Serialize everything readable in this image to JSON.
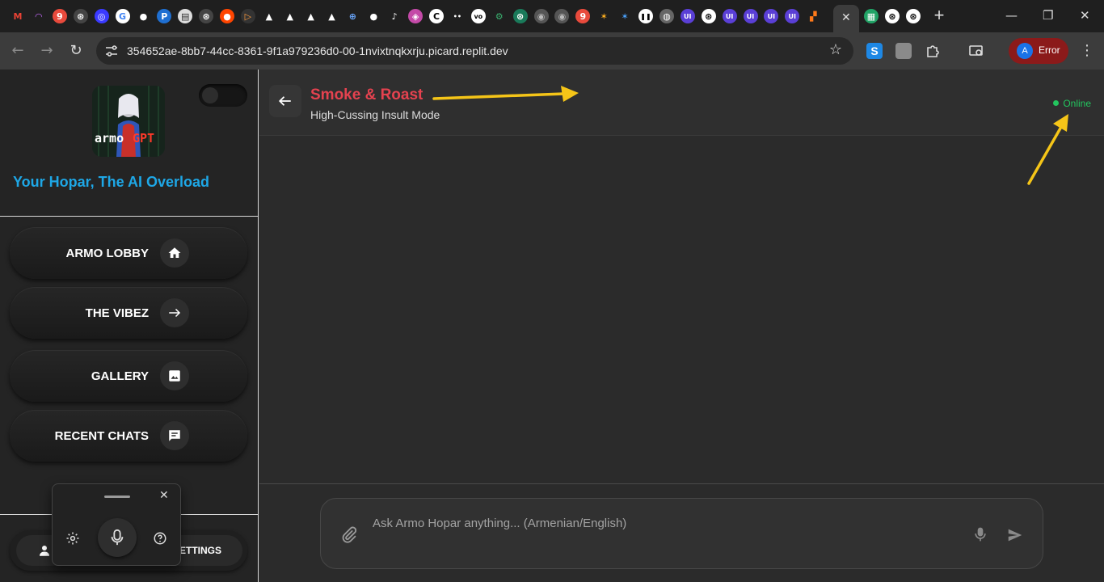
{
  "browser": {
    "url": "354652ae-8bb7-44cc-8361-9f1a979236d0-00-1nvixtnqkxrju.picard.replit.dev",
    "profile_label": "Error",
    "profile_initial": "A",
    "new_tab_glyph": "+",
    "tab_close_glyph": "✕",
    "favicons": [
      {
        "icon": "gmail-icon",
        "glyph": "M",
        "color": "#ea4335",
        "bg": "transparent"
      },
      {
        "icon": "rainbow-icon",
        "glyph": "◠",
        "color": "#c86cff",
        "bg": "transparent"
      },
      {
        "icon": "nine-icon",
        "glyph": "9",
        "color": "#fff",
        "bg": "#e84a3c"
      },
      {
        "icon": "openai-icon",
        "glyph": "⊛",
        "color": "#fff",
        "bg": "#444"
      },
      {
        "icon": "circle-blue-icon",
        "glyph": "◎",
        "color": "#fff",
        "bg": "#3a3aff"
      },
      {
        "icon": "google-icon",
        "glyph": "G",
        "color": "#4285f4",
        "bg": "#fff"
      },
      {
        "icon": "github-icon",
        "glyph": "●",
        "color": "#fff",
        "bg": "transparent"
      },
      {
        "icon": "paypal-icon",
        "glyph": "P",
        "color": "#fff",
        "bg": "#1f6fd1"
      },
      {
        "icon": "doc-icon",
        "glyph": "▤",
        "color": "#333",
        "bg": "#ddd"
      },
      {
        "icon": "openai-icon",
        "glyph": "⊛",
        "color": "#fff",
        "bg": "#444"
      },
      {
        "icon": "reddit-icon",
        "glyph": "●",
        "color": "#fff",
        "bg": "#ff4500"
      },
      {
        "icon": "play-icon",
        "glyph": "▷",
        "color": "#ff9b3d",
        "bg": "#333"
      },
      {
        "icon": "triangle-icon",
        "glyph": "▲",
        "color": "#fff",
        "bg": "transparent"
      },
      {
        "icon": "triangle-icon",
        "glyph": "▲",
        "color": "#fff",
        "bg": "transparent"
      },
      {
        "icon": "triangle-icon",
        "glyph": "▲",
        "color": "#fff",
        "bg": "transparent"
      },
      {
        "icon": "triangle-icon",
        "glyph": "▲",
        "color": "#fff",
        "bg": "transparent"
      },
      {
        "icon": "plus-circle-icon",
        "glyph": "⊕",
        "color": "#6aa8ff",
        "bg": "transparent"
      },
      {
        "icon": "github-icon",
        "glyph": "●",
        "color": "#fff",
        "bg": "transparent"
      },
      {
        "icon": "tiktok-icon",
        "glyph": "♪",
        "color": "#fff",
        "bg": "transparent"
      },
      {
        "icon": "gradient-icon",
        "glyph": "◈",
        "color": "#fff",
        "bg": "#c44aa8"
      },
      {
        "icon": "c-icon",
        "glyph": "C",
        "color": "#000",
        "bg": "#fff"
      },
      {
        "icon": "dots-icon",
        "glyph": "••",
        "color": "#fff",
        "bg": "transparent"
      },
      {
        "icon": "vo-icon",
        "glyph": "vo",
        "color": "#000",
        "bg": "#fff"
      },
      {
        "icon": "grid-icon",
        "glyph": "⚙",
        "color": "#3ab06f",
        "bg": "transparent"
      },
      {
        "icon": "openai-icon",
        "glyph": "⊛",
        "color": "#fff",
        "bg": "#1a7a5a"
      },
      {
        "icon": "avatar-icon",
        "glyph": "◉",
        "color": "#bbb",
        "bg": "#555"
      },
      {
        "icon": "avatar-icon",
        "glyph": "◉",
        "color": "#bbb",
        "bg": "#555"
      },
      {
        "icon": "nine-icon",
        "glyph": "9",
        "color": "#fff",
        "bg": "#e84a3c"
      },
      {
        "icon": "figure-icon",
        "glyph": "✶",
        "color": "#ffb020",
        "bg": "transparent"
      },
      {
        "icon": "figure-icon",
        "glyph": "✶",
        "color": "#4aa3ff",
        "bg": "transparent"
      },
      {
        "icon": "pause-icon",
        "glyph": "❚❚",
        "color": "#000",
        "bg": "#fff"
      },
      {
        "icon": "chrome-icon",
        "glyph": "◍",
        "color": "#fff",
        "bg": "#666"
      },
      {
        "icon": "ui-icon",
        "glyph": "UI",
        "color": "#fff",
        "bg": "#5a3fd6"
      },
      {
        "icon": "openai-icon",
        "glyph": "⊛",
        "color": "#000",
        "bg": "#fff"
      },
      {
        "icon": "ui-icon",
        "glyph": "UI",
        "color": "#fff",
        "bg": "#5a3fd6"
      },
      {
        "icon": "ui-icon",
        "glyph": "UI",
        "color": "#fff",
        "bg": "#5a3fd6"
      },
      {
        "icon": "ui-icon",
        "glyph": "UI",
        "color": "#fff",
        "bg": "#5a3fd6"
      },
      {
        "icon": "ui-icon",
        "glyph": "UI",
        "color": "#fff",
        "bg": "#5a3fd6"
      },
      {
        "icon": "blocks-icon",
        "glyph": "▞",
        "color": "#ff7a1a",
        "bg": "transparent"
      }
    ],
    "after_tab_favicons": [
      {
        "icon": "sheet-icon",
        "glyph": "▦",
        "color": "#fff",
        "bg": "#21a366"
      },
      {
        "icon": "openai-icon",
        "glyph": "⊛",
        "color": "#000",
        "bg": "#fff"
      },
      {
        "icon": "openai-icon",
        "glyph": "⊛",
        "color": "#000",
        "bg": "#fff"
      }
    ]
  },
  "sidebar": {
    "logo_text_a": "armo",
    "logo_text_b": "GPT",
    "tagline": "Your Hopar, The AI Overload",
    "nav": [
      {
        "label": "ARMO LOBBY",
        "icon": "home-icon"
      },
      {
        "label": "THE VIBEZ",
        "icon": "arrow-right-icon"
      },
      {
        "label": "GALLERY",
        "icon": "image-icon"
      },
      {
        "label": "RECENT CHATS",
        "icon": "chat-icon"
      }
    ],
    "bottom_label": "SETTINGS"
  },
  "chat": {
    "title": "Smoke & Roast",
    "subtitle": "High-Cussing Insult Mode",
    "status": "Online",
    "placeholder": "Ask Armo Hopar anything... (Armenian/English)"
  },
  "colors": {
    "accent_title": "#e5424f",
    "tagline": "#1ea7e6",
    "online": "#23c55e",
    "annotation_arrow": "#f5c518"
  }
}
